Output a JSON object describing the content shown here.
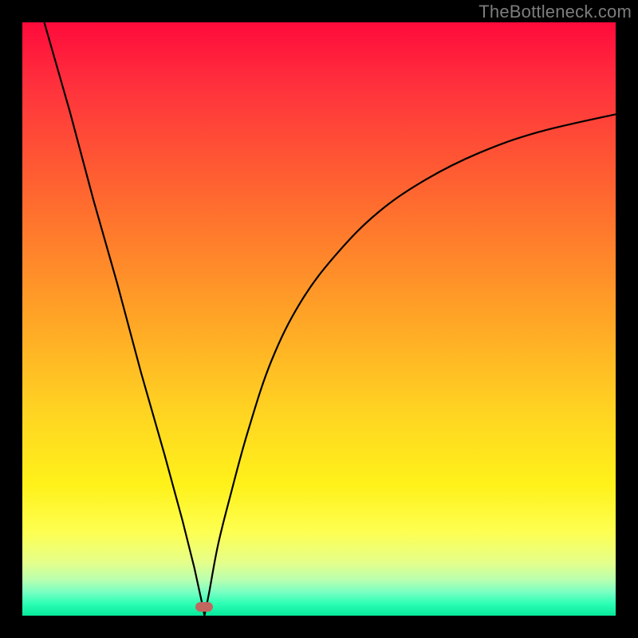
{
  "watermark": "TheBottleneck.com",
  "marker": {
    "color": "#c1675f",
    "x_frac": 0.307,
    "y_frac": 0.985
  },
  "colors": {
    "curve_stroke": "#000000",
    "frame": "#000000"
  },
  "chart_data": {
    "type": "line",
    "title": "",
    "xlabel": "",
    "ylabel": "",
    "xlim": [
      0,
      1
    ],
    "ylim": [
      0,
      1
    ],
    "note": "V-shaped bottleneck curve; x is normalized component balance, y is bottleneck percentage (0 at minimum). Left branch is steep/near-linear, right branch is an asymptotic rise.",
    "minimum_x": 0.307,
    "series": [
      {
        "name": "left-branch",
        "x": [
          0.037,
          0.08,
          0.12,
          0.16,
          0.2,
          0.24,
          0.27,
          0.29,
          0.302,
          0.307
        ],
        "y": [
          1.0,
          0.85,
          0.7,
          0.56,
          0.41,
          0.27,
          0.16,
          0.08,
          0.025,
          0.0
        ]
      },
      {
        "name": "right-branch",
        "x": [
          0.307,
          0.315,
          0.33,
          0.35,
          0.38,
          0.42,
          0.47,
          0.53,
          0.6,
          0.68,
          0.77,
          0.87,
          1.0
        ],
        "y": [
          0.0,
          0.04,
          0.12,
          0.2,
          0.31,
          0.43,
          0.53,
          0.61,
          0.68,
          0.735,
          0.78,
          0.815,
          0.845
        ]
      }
    ]
  }
}
